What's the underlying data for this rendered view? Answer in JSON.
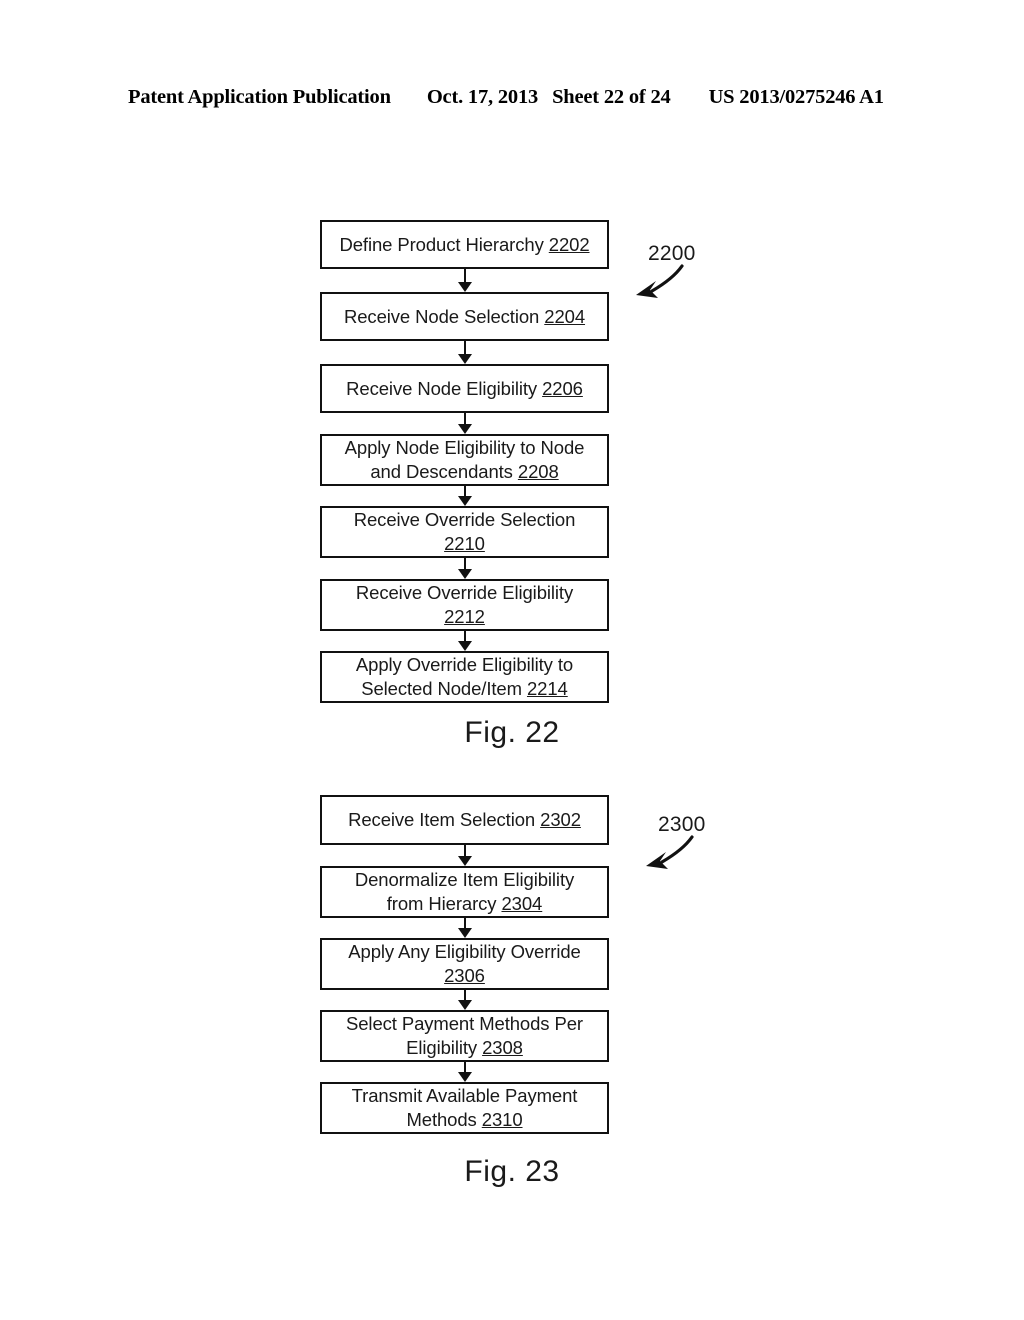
{
  "header": {
    "publication": "Patent Application Publication",
    "date": "Oct. 17, 2013",
    "sheet": "Sheet 22 of 24",
    "patent_number": "US 2013/0275246 A1"
  },
  "figures": [
    {
      "id": "2200",
      "caption": "Fig. 22",
      "callout_label": "2200",
      "steps": [
        {
          "id": "2202",
          "text": "Define Product Hierarchy ",
          "ref": "2202",
          "lines": [
            "Define Product Hierarchy 2202"
          ]
        },
        {
          "id": "2204",
          "text": "Receive Node Selection ",
          "ref": "2204",
          "lines": [
            "Receive Node Selection 2204"
          ]
        },
        {
          "id": "2206",
          "text": "Receive Node Eligibility ",
          "ref": "2206",
          "lines": [
            "Receive Node Eligibility 2206"
          ]
        },
        {
          "id": "2208",
          "text": "Apply Node Eligibility to Node and Descendants ",
          "ref": "2208",
          "line1": "Apply Node Eligibility to Node",
          "line2": "and Descendants "
        },
        {
          "id": "2210",
          "text": "Receive Override Selection ",
          "ref": "2210",
          "line1": "Receive Override Selection",
          "line2": ""
        },
        {
          "id": "2212",
          "text": "Receive Override Eligibility ",
          "ref": "2212",
          "line1": "Receive Override Eligibility",
          "line2": ""
        },
        {
          "id": "2214",
          "text": "Apply Override Eligibility to Selected Node/Item ",
          "ref": "2214",
          "line1": "Apply Override Eligibility to",
          "line2": "Selected Node/Item "
        }
      ]
    },
    {
      "id": "2300",
      "caption": "Fig. 23",
      "callout_label": "2300",
      "steps": [
        {
          "id": "2302",
          "text": "Receive Item Selection ",
          "ref": "2302",
          "lines": [
            "Receive Item Selection 2302"
          ]
        },
        {
          "id": "2304",
          "text": "Denormalize Item Eligibility from Hierarcy ",
          "ref": "2304",
          "line1": "Denormalize Item Eligibility",
          "line2": "from Hierarcy "
        },
        {
          "id": "2306",
          "text": "Apply Any Eligibility Override ",
          "ref": "2306",
          "line1": "Apply Any Eligibility Override",
          "line2": ""
        },
        {
          "id": "2308",
          "text": "Select Payment Methods Per Eligibility ",
          "ref": "2308",
          "line1": "Select Payment Methods Per",
          "line2": "Eligibility "
        },
        {
          "id": "2310",
          "text": "Transmit Available Payment Methods ",
          "ref": "2310",
          "line1": "Transmit Available Payment",
          "line2": "Methods "
        }
      ]
    }
  ],
  "boxes": {
    "b2202": {
      "line1": "Define Product Hierarchy ",
      "ref": "2202",
      "line2": ""
    },
    "b2204": {
      "line1": "Receive Node Selection ",
      "ref": "2204",
      "line2": ""
    },
    "b2206": {
      "line1": "Receive Node Eligibility ",
      "ref": "2206",
      "line2": ""
    },
    "b2208": {
      "line1": "Apply Node Eligibility to Node",
      "line2": "and Descendants ",
      "ref": "2208"
    },
    "b2210": {
      "line1": "Receive Override Selection",
      "line2": "",
      "ref": "2210"
    },
    "b2212": {
      "line1": "Receive Override Eligibility",
      "line2": "",
      "ref": "2212"
    },
    "b2214": {
      "line1": "Apply Override Eligibility to",
      "line2": "Selected Node/Item ",
      "ref": "2214"
    },
    "b2302": {
      "line1": "Receive Item Selection ",
      "ref": "2302",
      "line2": ""
    },
    "b2304": {
      "line1": "Denormalize Item Eligibility",
      "line2": "from Hierarcy ",
      "ref": "2304"
    },
    "b2306": {
      "line1": "Apply Any Eligibility Override",
      "line2": "",
      "ref": "2306"
    },
    "b2308": {
      "line1": "Select Payment Methods Per",
      "line2": "Eligibility ",
      "ref": "2308"
    },
    "b2310": {
      "line1": "Transmit Available Payment",
      "line2": "Methods ",
      "ref": "2310"
    }
  },
  "colors": {
    "ink": "#111111",
    "text": "#1a1a1a",
    "paper": "#ffffff"
  }
}
